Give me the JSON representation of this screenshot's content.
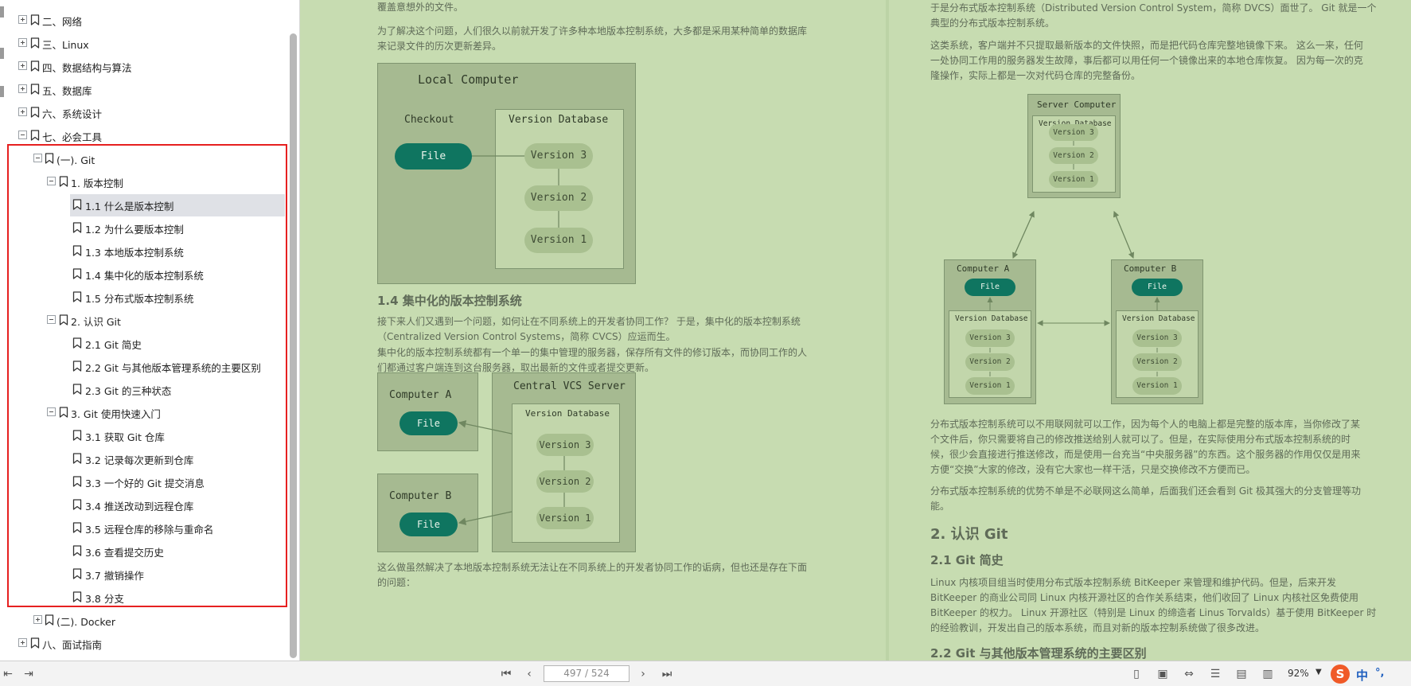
{
  "sidebar": {
    "items": [
      {
        "label": "二、网络",
        "level": 0,
        "expander": "plus"
      },
      {
        "label": "三、Linux",
        "level": 0,
        "expander": "plus"
      },
      {
        "label": "四、数据结构与算法",
        "level": 0,
        "expander": "plus"
      },
      {
        "label": "五、数据库",
        "level": 0,
        "expander": "plus"
      },
      {
        "label": "六、系统设计",
        "level": 0,
        "expander": "plus"
      },
      {
        "label": "七、必会工具",
        "level": 0,
        "expander": "minus"
      },
      {
        "label": "(一). Git",
        "level": 1,
        "expander": "minus"
      },
      {
        "label": "1. 版本控制",
        "level": 2,
        "expander": "minus"
      },
      {
        "label": "1.1 什么是版本控制",
        "level": 3,
        "expander": "none",
        "selected": true
      },
      {
        "label": "1.2 为什么要版本控制",
        "level": 3,
        "expander": "none"
      },
      {
        "label": "1.3 本地版本控制系统",
        "level": 3,
        "expander": "none"
      },
      {
        "label": "1.4 集中化的版本控制系统",
        "level": 3,
        "expander": "none"
      },
      {
        "label": "1.5 分布式版本控制系统",
        "level": 3,
        "expander": "none"
      },
      {
        "label": "2. 认识 Git",
        "level": 2,
        "expander": "minus"
      },
      {
        "label": "2.1 Git 简史",
        "level": 3,
        "expander": "none"
      },
      {
        "label": "2.2 Git 与其他版本管理系统的主要区别",
        "level": 3,
        "expander": "none"
      },
      {
        "label": "2.3 Git 的三种状态",
        "level": 3,
        "expander": "none"
      },
      {
        "label": "3. Git 使用快速入门",
        "level": 2,
        "expander": "minus"
      },
      {
        "label": "3.1 获取 Git 仓库",
        "level": 3,
        "expander": "none"
      },
      {
        "label": "3.2 记录每次更新到仓库",
        "level": 3,
        "expander": "none"
      },
      {
        "label": "3.3 一个好的 Git 提交消息",
        "level": 3,
        "expander": "none"
      },
      {
        "label": "3.4 推送改动到远程仓库",
        "level": 3,
        "expander": "none"
      },
      {
        "label": "3.5 远程仓库的移除与重命名",
        "level": 3,
        "expander": "none"
      },
      {
        "label": "3.6 查看提交历史",
        "level": 3,
        "expander": "none"
      },
      {
        "label": "3.7 撤销操作",
        "level": 3,
        "expander": "none"
      },
      {
        "label": "3.8 分支",
        "level": 3,
        "expander": "none"
      },
      {
        "label": "(二). Docker",
        "level": 1,
        "expander": "plus"
      },
      {
        "label": "八、面试指南",
        "level": 0,
        "expander": "plus"
      }
    ]
  },
  "left_page": {
    "top_fragment_1": "覆盖意想外的文件。",
    "para_intro": [
      "为了解决这个问题，人们很久以前就开发了许多种本地版本控制系统，大多都是采用某种简单的数据库",
      "来记录文件的历次更新差异。"
    ],
    "local_diagram": {
      "title": "Local Computer",
      "checkout": "Checkout",
      "db_title": "Version Database",
      "file": "File",
      "versions": [
        "Version 3",
        "Version 2",
        "Version 1"
      ]
    },
    "heading_14": "1.4 集中化的版本控制系统",
    "para_14a": [
      "接下来人们又遇到一个问题，如何让在不同系统上的开发者协同工作？ 于是，集中化的版本控制系统",
      "（Centralized Version Control Systems，简称 CVCS）应运而生。"
    ],
    "para_14b": [
      "集中化的版本控制系统都有一个单一的集中管理的服务器，保存所有文件的修订版本，而协同工作的人",
      "们都通过客户端连到这台服务器，取出最新的文件或者提交更新。"
    ],
    "central_diagram": {
      "computer_a": "Computer A",
      "computer_b": "Computer B",
      "server": "Central VCS Server",
      "db_title": "Version Database",
      "file": "File",
      "versions": [
        "Version 3",
        "Version 2",
        "Version 1"
      ]
    },
    "para_bottom": [
      "这么做虽然解决了本地版本控制系统无法让在不同系统上的开发者协同工作的诟病，但也还是存在下面",
      "的问题："
    ]
  },
  "right_page": {
    "para_top": [
      "于是分布式版本控制系统（Distributed Version Control System，简称 DVCS）面世了。 Git 就是一个",
      "典型的分布式版本控制系统。"
    ],
    "para_2": [
      "这类系统，客户端并不只提取最新版本的文件快照，而是把代码仓库完整地镜像下来。 这么一来，任何",
      "一处协同工作用的服务器发生故障，事后都可以用任何一个镜像出来的本地仓库恢复。 因为每一次的克",
      "隆操作，实际上都是一次对代码仓库的完整备份。"
    ],
    "dist_diagram": {
      "server": "Server Computer",
      "db_title": "Version Database",
      "computer_a": "Computer A",
      "computer_b": "Computer B",
      "file": "File",
      "versions": [
        "Version 3",
        "Version 2",
        "Version 1"
      ]
    },
    "para_3": [
      "分布式版本控制系统可以不用联网就可以工作，因为每个人的电脑上都是完整的版本库，当你修改了某",
      "个文件后，你只需要将自己的修改推送给别人就可以了。但是，在实际使用分布式版本控制系统的时",
      "候，很少会直接进行推送修改，而是使用一台充当“中央服务器”的东西。这个服务器的作用仅仅是用来",
      "方便“交换”大家的修改，没有它大家也一样干活，只是交换修改不方便而已。"
    ],
    "para_4": [
      "分布式版本控制系统的优势不单是不必联网这么简单，后面我们还会看到 Git 极其强大的分支管理等功",
      "能。"
    ],
    "heading_2": "2. 认识 Git",
    "heading_21": "2.1 Git 简史",
    "para_21": [
      "Linux 内核项目组当时使用分布式版本控制系统 BitKeeper 来管理和维护代码。但是，后来开发",
      "BitKeeper 的商业公司同 Linux 内核开源社区的合作关系结束，他们收回了 Linux 内核社区免费使用",
      "BitKeeper 的权力。 Linux 开源社区（特别是 Linux 的缔造者 Linus Torvalds）基于使用 BitKeeper 时",
      "的经验教训，开发出自己的版本系统，而且对新的版本控制系统做了很多改进。"
    ],
    "heading_22": "2.2 Git 与其他版本管理系统的主要区别"
  },
  "toolbar": {
    "page_indicator": "497 / 524",
    "zoom": "92%",
    "ime_zh": "中",
    "ime_punct": "°,"
  }
}
